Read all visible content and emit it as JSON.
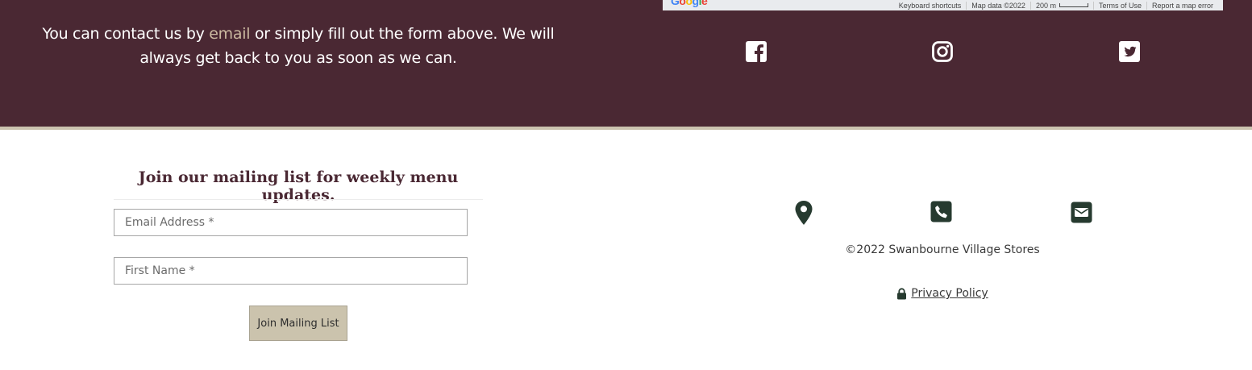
{
  "contact": {
    "text_before": "You can contact us by ",
    "email_link": "email",
    "text_after": " or simply fill out the form above. We will always get back to you as soon as we can."
  },
  "map": {
    "logo": [
      "G",
      "o",
      "o",
      "g",
      "l",
      "e"
    ],
    "keyboard_shortcuts": "Keyboard shortcuts",
    "map_data": "Map data ©2022",
    "scale": "200 m",
    "terms": "Terms of Use",
    "report": "Report a map error"
  },
  "social": {
    "icons": [
      "facebook-icon",
      "instagram-icon",
      "twitter-icon"
    ]
  },
  "mailing": {
    "title": "Join our mailing list for weekly menu updates.",
    "email_placeholder": "Email Address *",
    "firstname_placeholder": "First Name *",
    "button_label": "Join Mailing List"
  },
  "footer": {
    "icons": [
      "map-pin-icon",
      "phone-icon",
      "envelope-icon"
    ],
    "copyright": "©2022 Swanbourne Village Stores",
    "privacy_label": "Privacy Policy"
  },
  "colors": {
    "maroon": "#4a2833",
    "beige": "#cbc3ad",
    "link_beige": "#cbb9a0",
    "icon_dark_green": "#263a2f"
  }
}
